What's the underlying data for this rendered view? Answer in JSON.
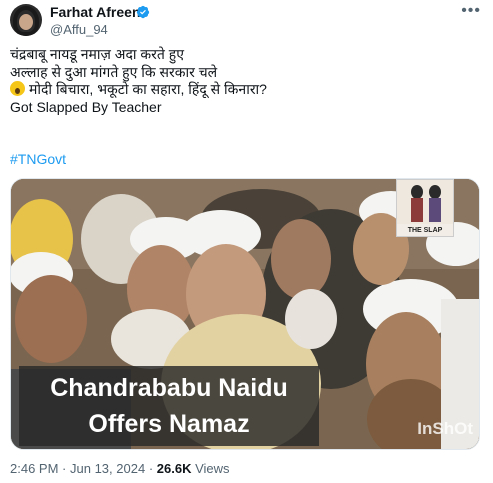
{
  "author": {
    "name": "Farhat Afreen",
    "handle": "@Affu_94",
    "verified_icon": "verified-badge-icon",
    "accent": "#1d9bf0"
  },
  "more_icon": "more-options-icon",
  "tweet": {
    "line1": "चंद्रबाबू नायडू नमाज़ अदा करते हुए",
    "line2": "अल्लाह से दुआ मांगते हुए कि सरकार चले",
    "line3": "मोदी बिचारा, भकूटो का सहारा, हिंदू से किनारा?",
    "line3_icon": "screaming-face-emoji-icon",
    "line4": "Got Slapped By Teacher",
    "hashtag": "#TNGovt"
  },
  "media": {
    "caption_line1": "Chandrababu Naidu",
    "caption_line2": "Offers Namaz",
    "watermark": "InShOt",
    "inset_label": "THE SLAP"
  },
  "meta": {
    "time": "2:46 PM",
    "date": "Jun 13, 2024",
    "views_count": "26.6K",
    "views_label": "Views"
  }
}
